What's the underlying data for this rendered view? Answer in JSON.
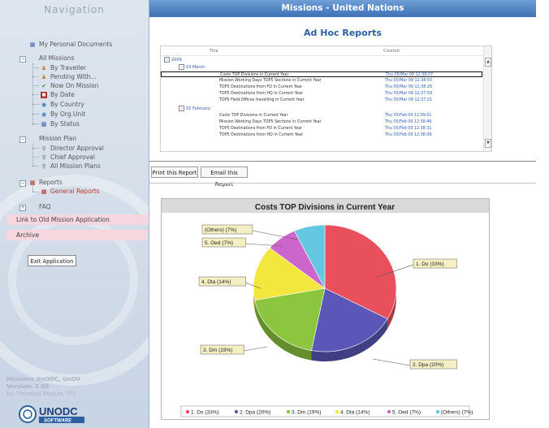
{
  "window": {
    "title": "Missions - United Nations"
  },
  "sidebar": {
    "title": "Navigation",
    "items": [
      {
        "label": "My Personal Documents",
        "icon": "document-icon"
      },
      {
        "label": "All Missions",
        "icon": "folder-icon"
      },
      {
        "label": "By Traveller",
        "icon": "person-icon"
      },
      {
        "label": "Pending With...",
        "icon": "person-icon"
      },
      {
        "label": "Now On Mission",
        "icon": "checkmark-icon"
      },
      {
        "label": "By Date",
        "icon": "calendar-icon"
      },
      {
        "label": "By Country",
        "icon": "globe-icon"
      },
      {
        "label": "By Org.Unit",
        "icon": "org-icon"
      },
      {
        "label": "By Status",
        "icon": "status-icon"
      },
      {
        "label": "Mission Plan",
        "icon": "folder-icon"
      },
      {
        "label": "Director Approval",
        "icon": "magnifier-icon"
      },
      {
        "label": "Chief Approval",
        "icon": "magnifier-icon"
      },
      {
        "label": "All Mission Plans",
        "icon": "magnifier-icon"
      },
      {
        "label": "Reports",
        "icon": "chart-icon"
      },
      {
        "label": "General Reports",
        "icon": "chart-icon"
      },
      {
        "label": "FAQ",
        "icon": "folder-icon"
      }
    ],
    "link_old": "Link to Old Mission Application",
    "archive": "Archive",
    "exit_button": "Exit Application",
    "footer_line1": "Missions UnODC, UnOV",
    "footer_line2": "Version:   3.00",
    "footer_line3": "by Thomas Meyer, ITS",
    "logo_text": "UNODC",
    "logo_sub": "SOFTWARE"
  },
  "main": {
    "title": "Ad Hoc Reports",
    "table": {
      "col_title": "Title",
      "col_created": "Created",
      "year": "2009",
      "groups": [
        {
          "label": "03 March",
          "rows": [
            {
              "title": "Costs TOP Divisions in Current Year",
              "created": "Thu 05/Mar 09 12:38:07",
              "selected": true
            },
            {
              "title": "Mission Working Days TOP5 Sections in Current Year",
              "created": "Thu 05/Mar 09 12:38:50"
            },
            {
              "title": "TOP5 Destinations from FO in Current Year",
              "created": "Thu 05/Mar 09 12:38:26"
            },
            {
              "title": "TOP5 Destinations from HQ in Current Year",
              "created": "Thu 05/Mar 09 12:37:59"
            },
            {
              "title": "TOP5 Field Offices travelling in Current Year",
              "created": "Thu 05/Mar 09 12:37:21"
            }
          ]
        },
        {
          "label": "02 February",
          "rows": [
            {
              "title": "Costs TOP Divisions in Current Year",
              "created": "Thu 05/Feb 09 12:09:01"
            },
            {
              "title": "Mission Working Days TOP5 Sections in Current Year",
              "created": "Thu 05/Feb 09 12:38:46"
            },
            {
              "title": "TOP5 Destinations from FO in Current Year",
              "created": "Thu 05/Feb 09 12:38:31"
            },
            {
              "title": "TOP5 Destinations from HQ in Current Year",
              "created": "Thu 05/Feb 09 12:38:09"
            }
          ]
        }
      ]
    },
    "toolbar": {
      "print_label": "Print this Report",
      "email_label": "Email this Report"
    }
  },
  "chart_data": {
    "type": "pie",
    "title": "Costs TOP Divisions in Current Year",
    "categories": [
      "1. Do",
      "2. Dpa",
      "3. Dm",
      "4. Dta",
      "5. Oed",
      "(Others)"
    ],
    "values": [
      33,
      20,
      19,
      14,
      7,
      7
    ],
    "data_labels": [
      "1. Do (33%)",
      "2. Dpa (20%)",
      "3. Dm (19%)",
      "4. Dta (14%)",
      "5. Oed (7%)",
      "(Others) (7%)"
    ],
    "legend": [
      "1. Do (33%)",
      "2. Dpa (20%)",
      "3. Dm (19%)",
      "4. Dta (14%)",
      "5. Oed (7%)",
      "(Others) (7%)"
    ],
    "colors": [
      "#e8505b",
      "#5a57b8",
      "#8cc63f",
      "#f3e63c",
      "#cc66cc",
      "#66c8e0"
    ],
    "legend_placement": "bottom"
  }
}
